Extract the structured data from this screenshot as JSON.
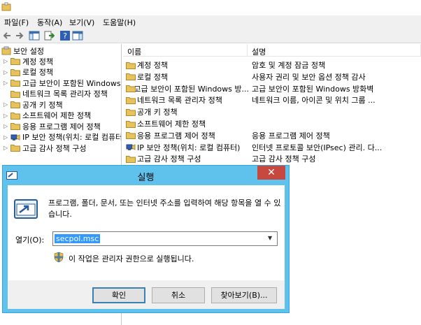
{
  "menubar": {
    "items": [
      "파일(F)",
      "동작(A)",
      "보기(V)",
      "도움말(H)"
    ]
  },
  "tree": {
    "root": "보안 설정",
    "items": [
      {
        "label": "계정 정책",
        "expandable": true
      },
      {
        "label": "로컬 정책",
        "expandable": true
      },
      {
        "label": "고급 보안이 포함된 Windows",
        "expandable": true
      },
      {
        "label": "네트워크 목록 관리자 정책",
        "expandable": false
      },
      {
        "label": "공개 키 정책",
        "expandable": true
      },
      {
        "label": "소프트웨어 제한 정책",
        "expandable": true
      },
      {
        "label": "응용 프로그램 제어 정책",
        "expandable": true
      },
      {
        "label": "IP 보안 정책(위치: 로컬 컴퓨터",
        "expandable": true,
        "icon": "ip-security-icon"
      },
      {
        "label": "고급 감사 정책 구성",
        "expandable": true
      }
    ]
  },
  "list": {
    "columns": [
      "이름",
      "설명"
    ],
    "rows": [
      {
        "name": "계정 정책",
        "desc": "암호 및 계정 잠금 정책"
      },
      {
        "name": "로컬 정책",
        "desc": "사용자 권리 및 보안 옵션 정책 감사"
      },
      {
        "name": "고급 보안이 포함된 Windows 방...",
        "desc": "고급 보안이 포함된 Windows 방화벽"
      },
      {
        "name": "네트워크 목록 관리자 정책",
        "desc": "네트워크 이름, 아이콘 및 위치 그룹 ..."
      },
      {
        "name": "공개 키 정책",
        "desc": ""
      },
      {
        "name": "소프트웨어 제한 정책",
        "desc": ""
      },
      {
        "name": "응용 프로그램 제어 정책",
        "desc": "응용 프로그램 제어 정책"
      },
      {
        "name": "IP 보안 정책(위치: 로컬 컴퓨터)",
        "desc": "인터넷 프로토콜 보안(IPsec) 관리. 다...",
        "icon": "ip-security-icon"
      },
      {
        "name": "고급 감사 정책 구성",
        "desc": "고급 감사 정책 구성"
      }
    ]
  },
  "run_dialog": {
    "title": "실행",
    "close_glyph": "✕",
    "description": "프로그램, 폴더, 문서, 또는 인터넷 주소를 입력하여 해당 항목을 열 수 있습니다.",
    "open_label": "열기(O):",
    "open_value": "secpol.msc",
    "admin_note": "이 작업은 관리자 권한으로 실행됩니다.",
    "buttons": {
      "ok": "확인",
      "cancel": "취소",
      "browse": "찾아보기(B)..."
    }
  },
  "colors": {
    "dialog_frame": "#5fc2ed",
    "close_button": "#c7483e",
    "selection": "#3399ff",
    "folder": "#e8c25a"
  }
}
